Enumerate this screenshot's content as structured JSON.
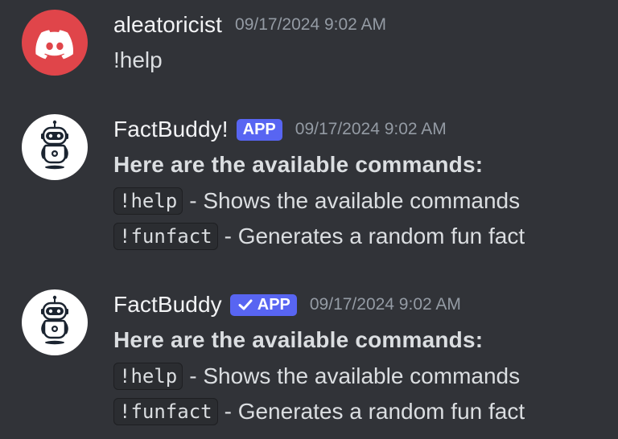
{
  "messages": [
    {
      "username": "aleatoricist",
      "timestamp": "09/17/2024 9:02 AM",
      "avatar_icon": "discord-logo-icon",
      "avatar_color": "#e0454a",
      "text": "!help"
    },
    {
      "username": "FactBuddy!",
      "badge": "APP",
      "badge_verified": false,
      "timestamp": "09/17/2024 9:02 AM",
      "avatar_icon": "robot-icon",
      "heading": "Here are the available commands:",
      "commands": [
        {
          "code": "!help",
          "desc": "- Shows the available commands"
        },
        {
          "code": "!funfact",
          "desc": "- Generates a random fun fact"
        }
      ]
    },
    {
      "username": "FactBuddy",
      "badge": "APP",
      "badge_verified": true,
      "badge_icon": "checkmark-icon",
      "timestamp": "09/17/2024 9:02 AM",
      "avatar_icon": "robot-icon",
      "heading": "Here are the available commands:",
      "commands": [
        {
          "code": "!help",
          "desc": "- Shows the available commands"
        },
        {
          "code": "!funfact",
          "desc": "- Generates a random fun fact"
        }
      ]
    }
  ],
  "colors": {
    "background": "#313338",
    "badge": "#5865f2",
    "username": "#f2f3f5",
    "timestamp": "#949ba4",
    "text": "#dbdee1"
  }
}
